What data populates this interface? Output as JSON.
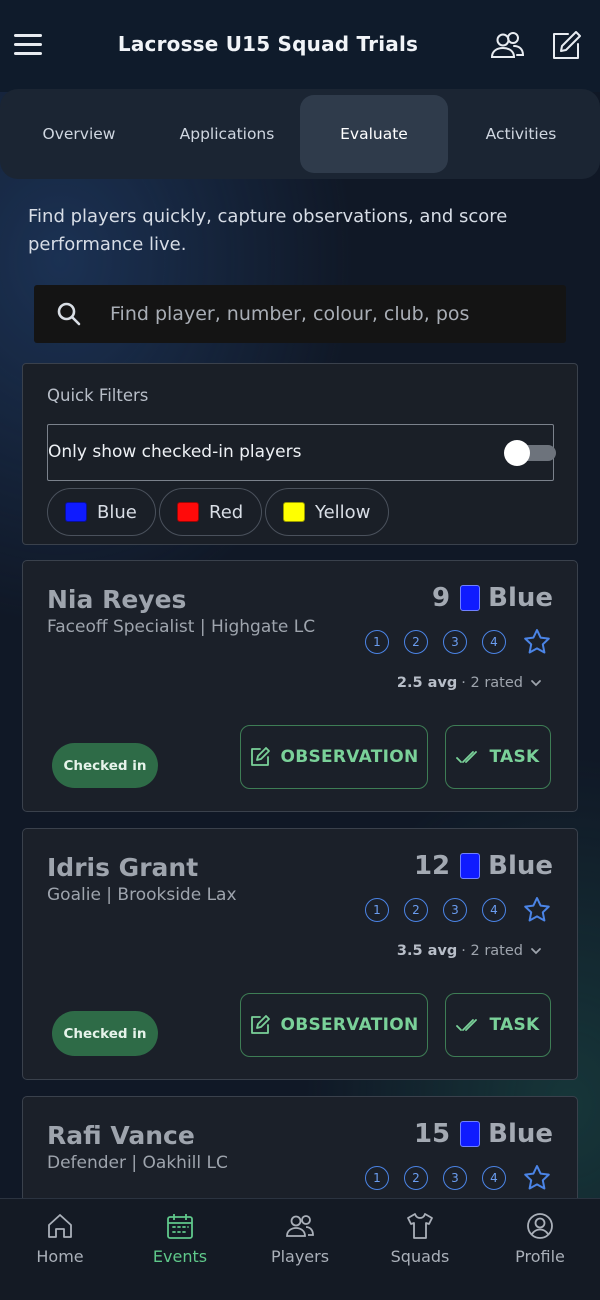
{
  "header": {
    "title": "Lacrosse U15 Squad Trials",
    "menu_icon": "hamburger-menu-icon",
    "icons": [
      "group-icon",
      "edit-icon"
    ]
  },
  "tabs": [
    {
      "label": "Overview",
      "active": false
    },
    {
      "label": "Applications",
      "active": false
    },
    {
      "label": "Evaluate",
      "active": true
    },
    {
      "label": "Activities",
      "active": false
    }
  ],
  "intro": "Find players quickly, capture observations, and score performance live.",
  "search": {
    "placeholder": "Find player, number, colour, club, pos",
    "value": ""
  },
  "filters": {
    "title": "Quick Filters",
    "toggle_label": "Only show checked-in players",
    "toggle_on": false,
    "chips": [
      {
        "label": "Blue",
        "color": "#0f1bff"
      },
      {
        "label": "Red",
        "color": "#ff0a0a"
      },
      {
        "label": "Yellow",
        "color": "#ffff00"
      }
    ]
  },
  "players": [
    {
      "name": "Nia Reyes",
      "role": "Faceoff Specialist | Highgate LC",
      "number": "9",
      "colour": "Blue",
      "colour_hex": "#0f1bff",
      "ratings": [
        "1",
        "2",
        "3",
        "4"
      ],
      "avg": "2.5 avg",
      "rated": "· 2 rated",
      "status": "Checked in",
      "observation_label": "OBSERVATION",
      "task_label": "TASK"
    },
    {
      "name": "Idris Grant",
      "role": "Goalie | Brookside Lax",
      "number": "12",
      "colour": "Blue",
      "colour_hex": "#0f1bff",
      "ratings": [
        "1",
        "2",
        "3",
        "4"
      ],
      "avg": "3.5 avg",
      "rated": "· 2 rated",
      "status": "Checked in",
      "observation_label": "OBSERVATION",
      "task_label": "TASK"
    },
    {
      "name": "Rafi Vance",
      "role": "Defender | Oakhill LC",
      "number": "15",
      "colour": "Blue",
      "colour_hex": "#0f1bff",
      "ratings": [
        "1",
        "2",
        "3",
        "4"
      ]
    }
  ],
  "bottom_nav": [
    {
      "label": "Home",
      "icon": "home-icon",
      "active": false
    },
    {
      "label": "Events",
      "icon": "calendar-icon",
      "active": true
    },
    {
      "label": "Players",
      "icon": "players-icon",
      "active": false
    },
    {
      "label": "Squads",
      "icon": "shirt-icon",
      "active": false
    },
    {
      "label": "Profile",
      "icon": "profile-icon",
      "active": false
    }
  ],
  "colors": {
    "accent_green": "#5fc88a",
    "rating_blue": "#4b84e6",
    "checked_in_bg": "#2e6b47"
  }
}
